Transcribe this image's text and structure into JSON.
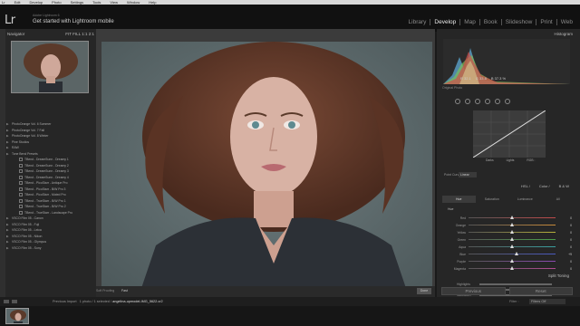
{
  "menubar": [
    "Lr",
    "Edit",
    "Develop",
    "Photo",
    "Settings",
    "Tools",
    "View",
    "Window",
    "Help"
  ],
  "identity": {
    "logo": "Lr",
    "subtitle": "Adobe Lightroom 6",
    "title": "Get started with Lightroom mobile"
  },
  "modules": [
    {
      "label": "Library",
      "active": false
    },
    {
      "label": "Develop",
      "active": true
    },
    {
      "label": "Map",
      "active": false
    },
    {
      "label": "Book",
      "active": false
    },
    {
      "label": "Slideshow",
      "active": false
    },
    {
      "label": "Print",
      "active": false
    },
    {
      "label": "Web",
      "active": false
    }
  ],
  "navigator": {
    "title": "Navigator",
    "zoom_options": "FIT  FILL  1:1  2:1"
  },
  "presets": [
    {
      "label": "PhotoOrange Vol. 6 Summer",
      "sub": false
    },
    {
      "label": "PhotoOrange Vol. 7 Fall",
      "sub": false
    },
    {
      "label": "PhotoOrange Vol. 8 Winter",
      "sub": false
    },
    {
      "label": "Pine Studios",
      "sub": false
    },
    {
      "label": "RAW",
      "sub": false
    },
    {
      "label": "Tone Bend Presets",
      "sub": false
    },
    {
      "label": "TBend - DreamSunn - Dreamy 1",
      "sub": true
    },
    {
      "label": "TBend - DreamSunn - Dreamy 2",
      "sub": true
    },
    {
      "label": "TBend - DreamSunn - Dreamy 3",
      "sub": true
    },
    {
      "label": "TBend - DreamSunn - Dreamy 4",
      "sub": true
    },
    {
      "label": "TBend - PicoStarr - Antique Pro",
      "sub": true
    },
    {
      "label": "TBend - PicoStarr - B/W Pro 3",
      "sub": true
    },
    {
      "label": "TBend - PicoStarr - Muted Pro",
      "sub": true
    },
    {
      "label": "TBend - TrueStarr - B/W Pro 1",
      "sub": true
    },
    {
      "label": "TBend - TrueStarr - B/W Pro 2",
      "sub": true
    },
    {
      "label": "TBend - TrueStarr - Landscape Pro",
      "sub": true
    },
    {
      "label": "VSCO Film 05 - Canon",
      "sub": false
    },
    {
      "label": "VSCO Film 05 - Fuji",
      "sub": false
    },
    {
      "label": "VSCO Film 05 - Leica",
      "sub": false
    },
    {
      "label": "VSCO Film 05 - Nikon",
      "sub": false
    },
    {
      "label": "VSCO Film 05 - Olympus",
      "sub": false
    },
    {
      "label": "VSCO Film 05 - Sony",
      "sub": false
    }
  ],
  "left_buttons": {
    "copy": "Copy...",
    "paste": "Paste"
  },
  "toolbar": {
    "softproof_label": "Soft Proofing",
    "softproof_value": "Fast",
    "done": "Done"
  },
  "right": {
    "histogram_title": "Histogram",
    "stats": [
      "R  32.1",
      "G  33.8",
      "B  37.3 %"
    ],
    "original_photo": "Original Photo",
    "curve_labels": [
      "Darks",
      "Lights",
      "RGB :"
    ],
    "point_curve_label": "Point Curve :",
    "point_curve_value": "Linear",
    "hsl_head": [
      "HSL  /",
      "Color  /",
      "B & W"
    ],
    "hsl_tabs": [
      {
        "label": "Hue",
        "active": true
      },
      {
        "label": "Saturation",
        "active": false
      },
      {
        "label": "Luminance",
        "active": false
      },
      {
        "label": "All",
        "active": false
      }
    ],
    "hue_label": "Hue",
    "sliders": [
      {
        "label": "Red",
        "value": "0",
        "pos": 0.5,
        "color": "#c04a4a"
      },
      {
        "label": "Orange",
        "value": "0",
        "pos": 0.5,
        "color": "#c88a3a"
      },
      {
        "label": "Yellow",
        "value": "0",
        "pos": 0.5,
        "color": "#b8b03a"
      },
      {
        "label": "Green",
        "value": "0",
        "pos": 0.5,
        "color": "#4aa04a"
      },
      {
        "label": "Aqua",
        "value": "0",
        "pos": 0.5,
        "color": "#3aa0a0"
      },
      {
        "label": "Blue",
        "value": "+9",
        "pos": 0.55,
        "color": "#4a5ac0"
      },
      {
        "label": "Purple",
        "value": "0",
        "pos": 0.5,
        "color": "#8a4ab0"
      },
      {
        "label": "Magenta",
        "value": "0",
        "pos": 0.5,
        "color": "#b04a90"
      }
    ],
    "split_title": "Split Toning",
    "split_rows": [
      "Highlights",
      "Hue",
      "Saturation"
    ],
    "prev_button": "Previous",
    "reset_button": "Reset"
  },
  "filmbar": {
    "prev_import": "Previous Import",
    "count": "1 photo / 1 selected /",
    "filename": "angelina-upmodel-IMG_5622.cr2",
    "filter_label": "Filter :",
    "filter_value": "Filters Off"
  }
}
